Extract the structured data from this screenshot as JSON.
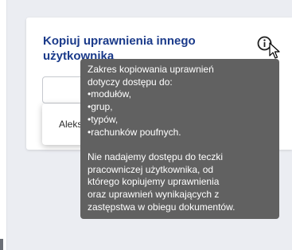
{
  "card": {
    "title": "Kopiuj uprawnienia innego użytkownika",
    "info_icon": "info-circle-icon"
  },
  "dropdown": {
    "option_label": "Aleks"
  },
  "tooltip": {
    "intro": [
      "Zakres kopiowania uprawnień",
      "dotyczy dostępu do:"
    ],
    "items": [
      "•modułów,",
      "•grup,",
      "•typów,",
      "•rachunków poufnych."
    ],
    "note": [
      "Nie nadajemy dostępu do teczki",
      "pracowniczej użytkownika, od",
      "którego kopiujemy uprawnienia",
      "oraz uprawnień wynikających z",
      "zastępstwa w obiegu dokumentów."
    ]
  },
  "colors": {
    "title": "#1a3a8a",
    "tooltip_bg": "#616161",
    "page_bg": "#ebedf2"
  }
}
